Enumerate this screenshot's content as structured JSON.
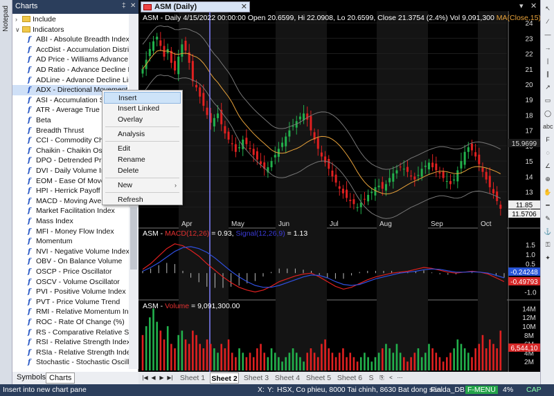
{
  "notepad": {
    "label": "Notepad"
  },
  "charts_panel": {
    "title": "Charts",
    "controls": [
      "‡",
      "✕"
    ],
    "tree": [
      {
        "type": "folder",
        "label": "Include",
        "expand": "›"
      },
      {
        "type": "folder",
        "label": "Indicators",
        "expand": "∨"
      },
      {
        "type": "fn",
        "label": "ABI - Absolute Breadth Index"
      },
      {
        "type": "fn",
        "label": "AccDist - Accumulation Distrib"
      },
      {
        "type": "fn",
        "label": "AD Price - Williams Advance D"
      },
      {
        "type": "fn",
        "label": "AD Ratio - Advance Decline R"
      },
      {
        "type": "fn",
        "label": "ADLine - Advance Decline Lin"
      },
      {
        "type": "fn",
        "label": "ADX - Directional Movement",
        "selected": true
      },
      {
        "type": "fn",
        "label": "ASI - Accumulation S"
      },
      {
        "type": "fn",
        "label": "ATR - Average True R"
      },
      {
        "type": "fn",
        "label": "Beta"
      },
      {
        "type": "fn",
        "label": "Breadth Thrust"
      },
      {
        "type": "fn",
        "label": "CCI - Commodity Cha"
      },
      {
        "type": "fn",
        "label": "Chaikin - Chaikin Osc"
      },
      {
        "type": "fn",
        "label": "DPO - Detrended Pric"
      },
      {
        "type": "fn",
        "label": "DVI - Daily Volume In"
      },
      {
        "type": "fn",
        "label": "EOM - Ease Of Mover"
      },
      {
        "type": "fn",
        "label": "HPI - Herrick Payoff I"
      },
      {
        "type": "fn",
        "label": "MACD - Moving Averg"
      },
      {
        "type": "fn",
        "label": "Market Facilitation Index"
      },
      {
        "type": "fn",
        "label": "Mass Index"
      },
      {
        "type": "fn",
        "label": "MFI - Money Flow Index"
      },
      {
        "type": "fn",
        "label": "Momentum"
      },
      {
        "type": "fn",
        "label": "NVI - Negative Volume Index"
      },
      {
        "type": "fn",
        "label": "OBV - On Balance Volume"
      },
      {
        "type": "fn",
        "label": "OSCP - Price Oscillator"
      },
      {
        "type": "fn",
        "label": "OSCV - Volume Oscillator"
      },
      {
        "type": "fn",
        "label": "PVI - Positive Volume Index"
      },
      {
        "type": "fn",
        "label": "PVT - Price Volume Trend"
      },
      {
        "type": "fn",
        "label": "RMI - Relative Momentum Ind"
      },
      {
        "type": "fn",
        "label": "ROC - Rate Of Change (%)"
      },
      {
        "type": "fn",
        "label": "RS - Comparative Relative Stre"
      },
      {
        "type": "fn",
        "label": "RSI - Relative Strength Index"
      },
      {
        "type": "fn",
        "label": "RSIa - Relative Strength Index"
      },
      {
        "type": "fn",
        "label": "Stochastic - Stochastic Oscill"
      }
    ],
    "bottom_tabs": [
      "Symbols",
      "Charts"
    ]
  },
  "context_menu": {
    "items": [
      {
        "label": "Insert",
        "highlighted": true
      },
      {
        "label": "Insert Linked"
      },
      {
        "label": "Overlay"
      },
      {
        "sep": true
      },
      {
        "label": "Analysis"
      },
      {
        "sep": true
      },
      {
        "label": "Edit"
      },
      {
        "label": "Rename"
      },
      {
        "label": "Delete"
      },
      {
        "sep": true
      },
      {
        "label": "New",
        "submenu": true
      },
      {
        "sep": true
      },
      {
        "label": "Refresh"
      }
    ]
  },
  "chart_tab": {
    "label": "ASM (Daily)",
    "close": "✕"
  },
  "window_controls": [
    "▾",
    "✕"
  ],
  "price_pane": {
    "title": "ASM - Daily 4/15/2022 00:00:00 Open 20.6599, Hi 22.0908, Lo 20.6599, Close 21.3754 (2.4%) Vol 9,091,300",
    "ma_label": "MA(Close,15)",
    "y_ticks": [
      "24",
      "23",
      "22",
      "21",
      "20",
      "19",
      "18",
      "17",
      "16",
      "15",
      "14",
      "13",
      "12"
    ],
    "price_boxes": [
      {
        "text": "15.9699",
        "bg": "#1a1a1a",
        "fg": "#dddddd"
      },
      {
        "text": "11.85",
        "bg": "#eeeeee",
        "fg": "#000000"
      },
      {
        "text": "11.5706",
        "bg": "#eeeeee",
        "fg": "#000000"
      }
    ],
    "months": [
      "Apr",
      "May",
      "Jun",
      "Jul",
      "Aug",
      "Sep",
      "Oct"
    ]
  },
  "macd_pane": {
    "name": "ASM - ",
    "macd": "MACD(12,26)",
    "macd_val": " = 0.93, ",
    "signal": "Signal(12,26,9)",
    "signal_val": " = 1.13",
    "y_ticks": [
      "1.5",
      "1.0",
      "0.5",
      "0.0",
      "-0.5",
      "-1.0"
    ],
    "boxes": [
      {
        "text": "-0.24248",
        "bg": "#2855d6",
        "fg": "#ffffff"
      },
      {
        "text": "-0.49793",
        "bg": "#d62828",
        "fg": "#ffffff"
      }
    ]
  },
  "volume_pane": {
    "name": "ASM - ",
    "vol": "Volume",
    "vol_val": " = 9,091,300.00",
    "y_ticks": [
      "14M",
      "12M",
      "10M",
      "8M",
      "6M",
      "4M",
      "2M"
    ],
    "box": {
      "text": "6,544,10",
      "bg": "#d62828",
      "fg": "#ffffff"
    }
  },
  "sheets": {
    "nav": [
      "|◀",
      "◀",
      "▶",
      "▶|"
    ],
    "tabs": [
      "Sheet 1",
      "Sheet 2",
      "Sheet 3",
      "Sheet 4",
      "Sheet 5",
      "Sheet 6",
      "S"
    ],
    "active_index": 1,
    "extra": [
      "⎘",
      "<",
      "⋯"
    ]
  },
  "toolbar_icons": [
    "cursor-icon",
    "line-icon",
    "hline-icon",
    "ray-icon",
    "vline-icon",
    "channel-icon",
    "arrow-icon",
    "rect-icon",
    "ellipse-icon",
    "text-icon",
    "abc-icon",
    "fib-icon",
    "cycle-icon",
    "gann-icon",
    "zoom-icon",
    "hand-icon",
    "ruler-icon",
    "pencil-icon",
    "magnet-icon",
    "lock-icon"
  ],
  "status": {
    "message": "Insert into new chart pane",
    "x": "X:",
    "y": "Y:",
    "symbol": "HSX, Co phieu, 8000 Tai chinh, 8630 Bat dong san",
    "db": "Fialda_DB",
    "fmenu": "F-MENU",
    "cpu": "4%",
    "cap": "CAP"
  },
  "chart_data": [
    {
      "type": "candlestick",
      "title": "ASM - Daily",
      "ylabel": "",
      "ylim": [
        11,
        24.5
      ],
      "x_months": [
        "Apr",
        "May",
        "Jun",
        "Jul",
        "Aug",
        "Sep",
        "Oct"
      ],
      "close_series": [
        21.0,
        21.6,
        22.3,
        22.8,
        23.1,
        22.5,
        21.8,
        22.3,
        21.4,
        20.9,
        21.8,
        22.6,
        22.2,
        21.4,
        20.2,
        19.8,
        19.2,
        18.6,
        18.0,
        17.5,
        17.8,
        18.1,
        17.4,
        16.8,
        16.4,
        16.1,
        15.6,
        15.9,
        16.4,
        16.1,
        15.8,
        15.4,
        15.1,
        14.8,
        14.5,
        14.6,
        15.0,
        15.4,
        15.8,
        16.2,
        16.6,
        17.0,
        17.3,
        17.6,
        17.9,
        18.1,
        17.7,
        17.0,
        16.4,
        15.8,
        15.3,
        14.9,
        14.5,
        14.0,
        13.6,
        13.2,
        12.9,
        12.6,
        12.4,
        12.2,
        12.0,
        12.3,
        12.5,
        12.8,
        13.0,
        13.3,
        13.4,
        13.2,
        13.5,
        13.9,
        14.2,
        14.4,
        14.6,
        14.5,
        14.3,
        14.0,
        13.8,
        14.1,
        14.5,
        14.7,
        14.9,
        14.6,
        14.4,
        14.2,
        13.9,
        13.7,
        13.5,
        13.8,
        14.4,
        15.0,
        15.6,
        15.9,
        15.7,
        15.3,
        14.8,
        14.3,
        13.8,
        13.3,
        12.9,
        12.4,
        11.9
      ],
      "ma_label": "MA(Close,15)"
    },
    {
      "type": "line",
      "title": "MACD",
      "ylim": [
        -1.2,
        1.8
      ],
      "series": [
        {
          "name": "MACD(12,26)",
          "values": [
            0.2,
            0.5,
            0.9,
            1.3,
            1.55,
            1.45,
            1.2,
            0.9,
            0.5,
            0.15,
            -0.2,
            -0.5,
            -0.75,
            -0.9,
            -1.0,
            -0.9,
            -0.7,
            -0.45,
            -0.3,
            -0.15,
            -0.05,
            0.0,
            -0.2,
            -0.45,
            -0.7,
            -0.85,
            -0.75,
            -0.55,
            -0.35,
            -0.2,
            -0.1,
            0.0,
            0.05,
            0.1,
            0.2,
            0.3,
            0.25,
            0.15,
            0.05,
            0.0,
            0.05,
            0.1,
            0.05,
            -0.05,
            -0.25,
            -0.45
          ]
        },
        {
          "name": "Signal(12,26,9)",
          "values": [
            0.1,
            0.3,
            0.55,
            0.85,
            1.15,
            1.35,
            1.4,
            1.3,
            1.1,
            0.8,
            0.45,
            0.1,
            -0.2,
            -0.45,
            -0.65,
            -0.75,
            -0.75,
            -0.65,
            -0.5,
            -0.35,
            -0.2,
            -0.1,
            -0.12,
            -0.25,
            -0.45,
            -0.6,
            -0.65,
            -0.6,
            -0.45,
            -0.3,
            -0.2,
            -0.1,
            0.0,
            0.05,
            0.1,
            0.18,
            0.22,
            0.2,
            0.12,
            0.05,
            0.05,
            0.07,
            0.05,
            0.0,
            -0.12,
            -0.25
          ]
        }
      ]
    },
    {
      "type": "bar",
      "title": "Volume",
      "ylim": [
        0,
        15
      ],
      "ylabel": "",
      "values_M": [
        8,
        10,
        12,
        14,
        11,
        9,
        7,
        10,
        6,
        5,
        8,
        9,
        7,
        6,
        9,
        8,
        6,
        5,
        7,
        6,
        5,
        4,
        6,
        5,
        7,
        4,
        3,
        5,
        4,
        3,
        4,
        3,
        5,
        6,
        4,
        3,
        5,
        4,
        3,
        2,
        3,
        4,
        5,
        4,
        3,
        2,
        4,
        5,
        4,
        3,
        6,
        7,
        5,
        4,
        3,
        4,
        5,
        3,
        4,
        3,
        2,
        3,
        4,
        3,
        2,
        3,
        4,
        5,
        6,
        5,
        4,
        6,
        4,
        3,
        2,
        3,
        4,
        5,
        3,
        4,
        6,
        5,
        4,
        3,
        2,
        3,
        4,
        5,
        7,
        6,
        5,
        4,
        3,
        5,
        6,
        8,
        5,
        7,
        6,
        5,
        9
      ]
    }
  ]
}
